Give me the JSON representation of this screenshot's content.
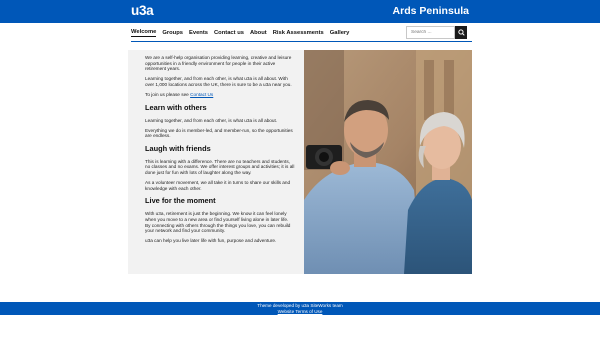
{
  "header": {
    "logo": "u3a",
    "site_title": "Ards Peninsula"
  },
  "nav": {
    "items": [
      {
        "label": "Welcome",
        "active": true
      },
      {
        "label": "Groups"
      },
      {
        "label": "Events"
      },
      {
        "label": "Contact us"
      },
      {
        "label": "About"
      },
      {
        "label": "Risk Assessments"
      },
      {
        "label": "Gallery"
      }
    ]
  },
  "search": {
    "placeholder": "Search ...",
    "icon": "search-icon"
  },
  "main": {
    "intro_1": "We are a self-help organisation providing learning, creative and leisure opportunities in a friendly environment for people in their active retirement years.",
    "intro_2": "Learning together, and from each other, is what u3a is all about. With over 1,000 locations across the UK, there is sure to be a u3a near you.",
    "join_prefix": "To join us please see ",
    "join_link": "Contact Us",
    "section_1": {
      "heading": "Learn with others",
      "p1": "Learning together, and from each other, is what u3a is all about.",
      "p2": "Everything we do is member-led, and member-run, so the opportunities are endless."
    },
    "section_2": {
      "heading": "Laugh with friends",
      "p1": "This is learning with a difference.  There are no teachers and students, no classes and no exams.  We offer interest groups and activities; it is all done just for fun with lots of laughter along the way.",
      "p2": "As a volunteer movement, we all take it in turns to share our skills and knowledge with each other."
    },
    "section_3": {
      "heading": "Live for the moment",
      "p1": "With u3a, retirement is just the beginning. We know it can feel lonely when you move to a new area or find yourself living alone in later life. By connecting with others through the things you love, you can rebuild your network and find your community.",
      "p2": "u3a can help you live later life with fun, purpose and adventure."
    }
  },
  "footer": {
    "credit": "Theme developed by u3a SiteWorks team",
    "terms_link": "Website Terms of Use"
  },
  "colors": {
    "brand_blue": "#0057b8",
    "panel_grey": "#f2f2f2"
  }
}
